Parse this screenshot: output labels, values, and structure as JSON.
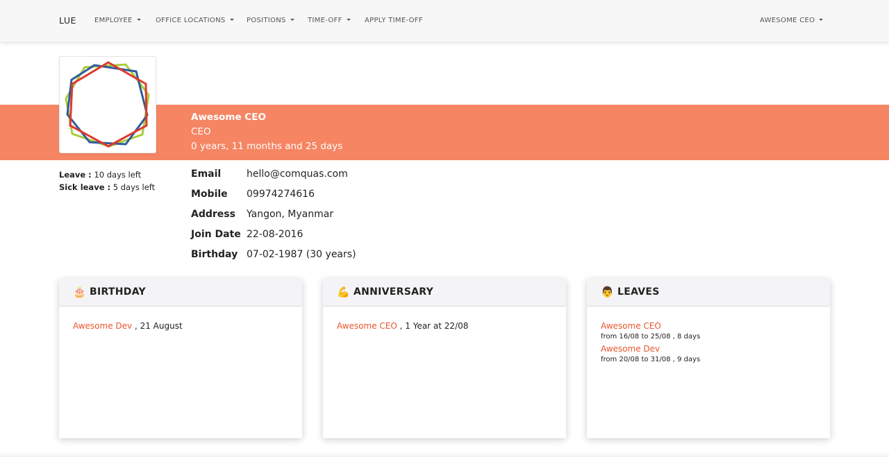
{
  "navbar": {
    "brand": "LUE",
    "items": [
      {
        "label": "EMPLOYEE",
        "dropdown": true
      },
      {
        "label": "OFFICE LOCATIONS",
        "dropdown": true
      },
      {
        "label": "POSITIONS",
        "dropdown": true
      },
      {
        "label": "TIME-OFF",
        "dropdown": true
      },
      {
        "label": "APPLY TIME-OFF",
        "dropdown": false
      }
    ],
    "user": {
      "label": "AWESOME CEO",
      "dropdown": true
    }
  },
  "profile": {
    "name": "Awesome CEO",
    "role": "CEO",
    "tenure": "0 years, 11 months and 25 days",
    "leave_label": "Leave :",
    "leave_value": "10 days left",
    "sick_label": "Sick leave :",
    "sick_value": "5 days left",
    "details": [
      {
        "label": "Email",
        "value": "hello@comquas.com"
      },
      {
        "label": "Mobile",
        "value": "09974274616"
      },
      {
        "label": "Address",
        "value": "Yangon, Myanmar"
      },
      {
        "label": "Join Date",
        "value": "22-08-2016"
      },
      {
        "label": "Birthday",
        "value": "07-02-1987 (30 years)"
      }
    ]
  },
  "cards": {
    "birthday": {
      "icon": "🎂",
      "title": "BIRTHDAY",
      "entries": [
        {
          "name": "Awesome Dev",
          "text": " , 21 August"
        }
      ]
    },
    "anniversary": {
      "icon": "💪",
      "title": "ANNIVERSARY",
      "entries": [
        {
          "name": "Awesome CEO",
          "text": " , 1 Year at 22/08"
        }
      ]
    },
    "leaves": {
      "icon": "👨",
      "title": "LEAVES",
      "entries": [
        {
          "name": "Awesome CEO",
          "detail": "from 16/08 to 25/08 , 8 days"
        },
        {
          "name": "Awesome Dev",
          "detail": "from 20/08 to 31/08 , 9 days"
        }
      ]
    }
  },
  "colors": {
    "accent": "#f58563",
    "link": "#e8552e",
    "navbar_bg": "#f7f7f7"
  }
}
